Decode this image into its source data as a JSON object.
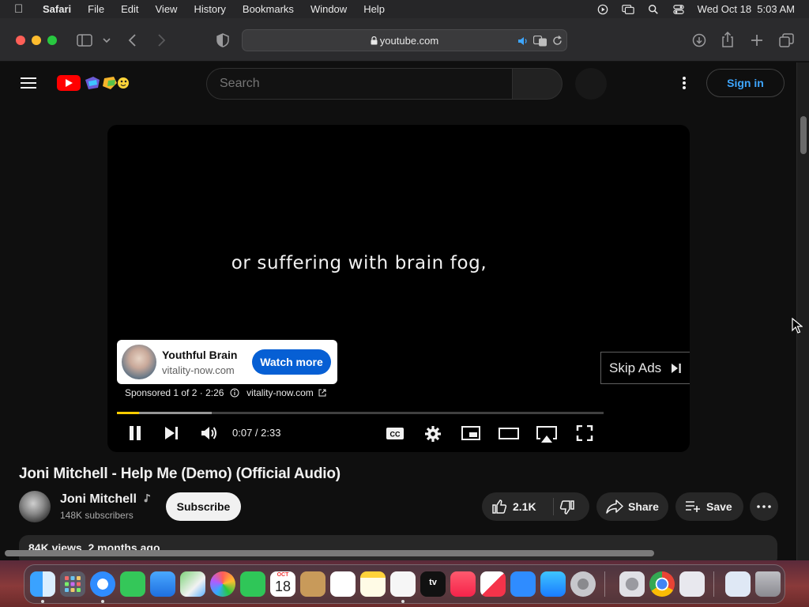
{
  "menubar": {
    "app": "Safari",
    "items": [
      "File",
      "Edit",
      "View",
      "History",
      "Bookmarks",
      "Window",
      "Help"
    ],
    "datetime": "Wed Oct 18  5:03 AM"
  },
  "browser": {
    "url": "youtube.com"
  },
  "youtube": {
    "search_placeholder": "Search",
    "sign_in": "Sign in"
  },
  "player": {
    "caption": "or suffering with brain fog,",
    "ad": {
      "title": "Youthful Brain",
      "domain": "vitality-now.com",
      "cta": "Watch more",
      "sponsored": "Sponsored 1 of 2 · 2:26",
      "sponsored_domain": "vitality-now.com"
    },
    "skip_label": "Skip Ads",
    "timecode": "0:07 / 2:33",
    "progress_played": 0.045,
    "progress_buffered": 0.195,
    "accent": "#ffcc00"
  },
  "video": {
    "title": "Joni Mitchell - Help Me (Demo) (Official Audio)",
    "channel": "Joni Mitchell",
    "subscribers": "148K subscribers",
    "subscribe": "Subscribe",
    "likes": "2.1K",
    "share": "Share",
    "save": "Save",
    "meta": "84K views  2 months ago"
  },
  "dock": {
    "calendar_month": "OCT",
    "calendar_day": "18",
    "tv_label": "tv"
  }
}
